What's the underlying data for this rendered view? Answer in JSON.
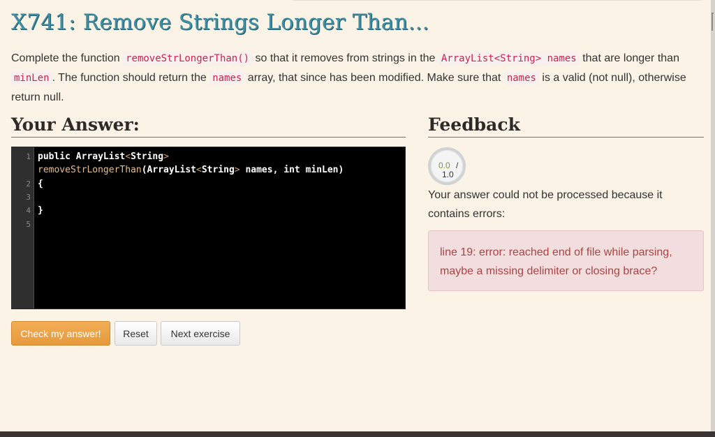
{
  "exercise": {
    "title": "X741: Remove Strings Longer Than...",
    "description": {
      "part1": "Complete the function ",
      "code1": "removeStrLongerThan()",
      "part2": " so that it removes from strings in the ",
      "code2": "ArrayList<String> names",
      "part3": " that are longer than ",
      "code3": "minLen",
      "part4": ". The function should return the ",
      "code4": "names",
      "part5": " array, that since has been modified. Make sure that ",
      "code5": "names",
      "part6": " is a valid (not null), otherwise return null."
    }
  },
  "answer": {
    "heading": "Your Answer:",
    "editor": {
      "line_numbers": [
        "1",
        "2",
        "3",
        "4",
        "5"
      ],
      "lines": {
        "l1_kw": "public",
        "l1_type": " ArrayList",
        "l1_lt": "<",
        "l1_generic": "String",
        "l1_gt": ">",
        "l1b_fn": "removeStrLongerThan",
        "l1b_paren": "(",
        "l1b_type": "ArrayList",
        "l1b_lt": "<",
        "l1b_generic": "String",
        "l1b_gt": ">",
        "l1b_rest": " names, int minLen)",
        "l2": "{",
        "l3": "",
        "l4": "}",
        "l5": ""
      }
    },
    "buttons": {
      "check": "Check my answer!",
      "reset": "Reset",
      "next": "Next exercise"
    }
  },
  "feedback": {
    "heading": "Feedback",
    "score": {
      "value": "0.0",
      "slash": "/",
      "max": "1.0"
    },
    "message": "Your answer could not be processed because it contains errors:",
    "error": "line 19: error: reached end of file while parsing, maybe a missing delimiter or closing brace?"
  },
  "colors": {
    "title": "#3f8ea4",
    "primary_button": "#e59a3b",
    "error_background": "#f2dede",
    "error_text": "#a94442",
    "code_text": "#c7254e"
  }
}
